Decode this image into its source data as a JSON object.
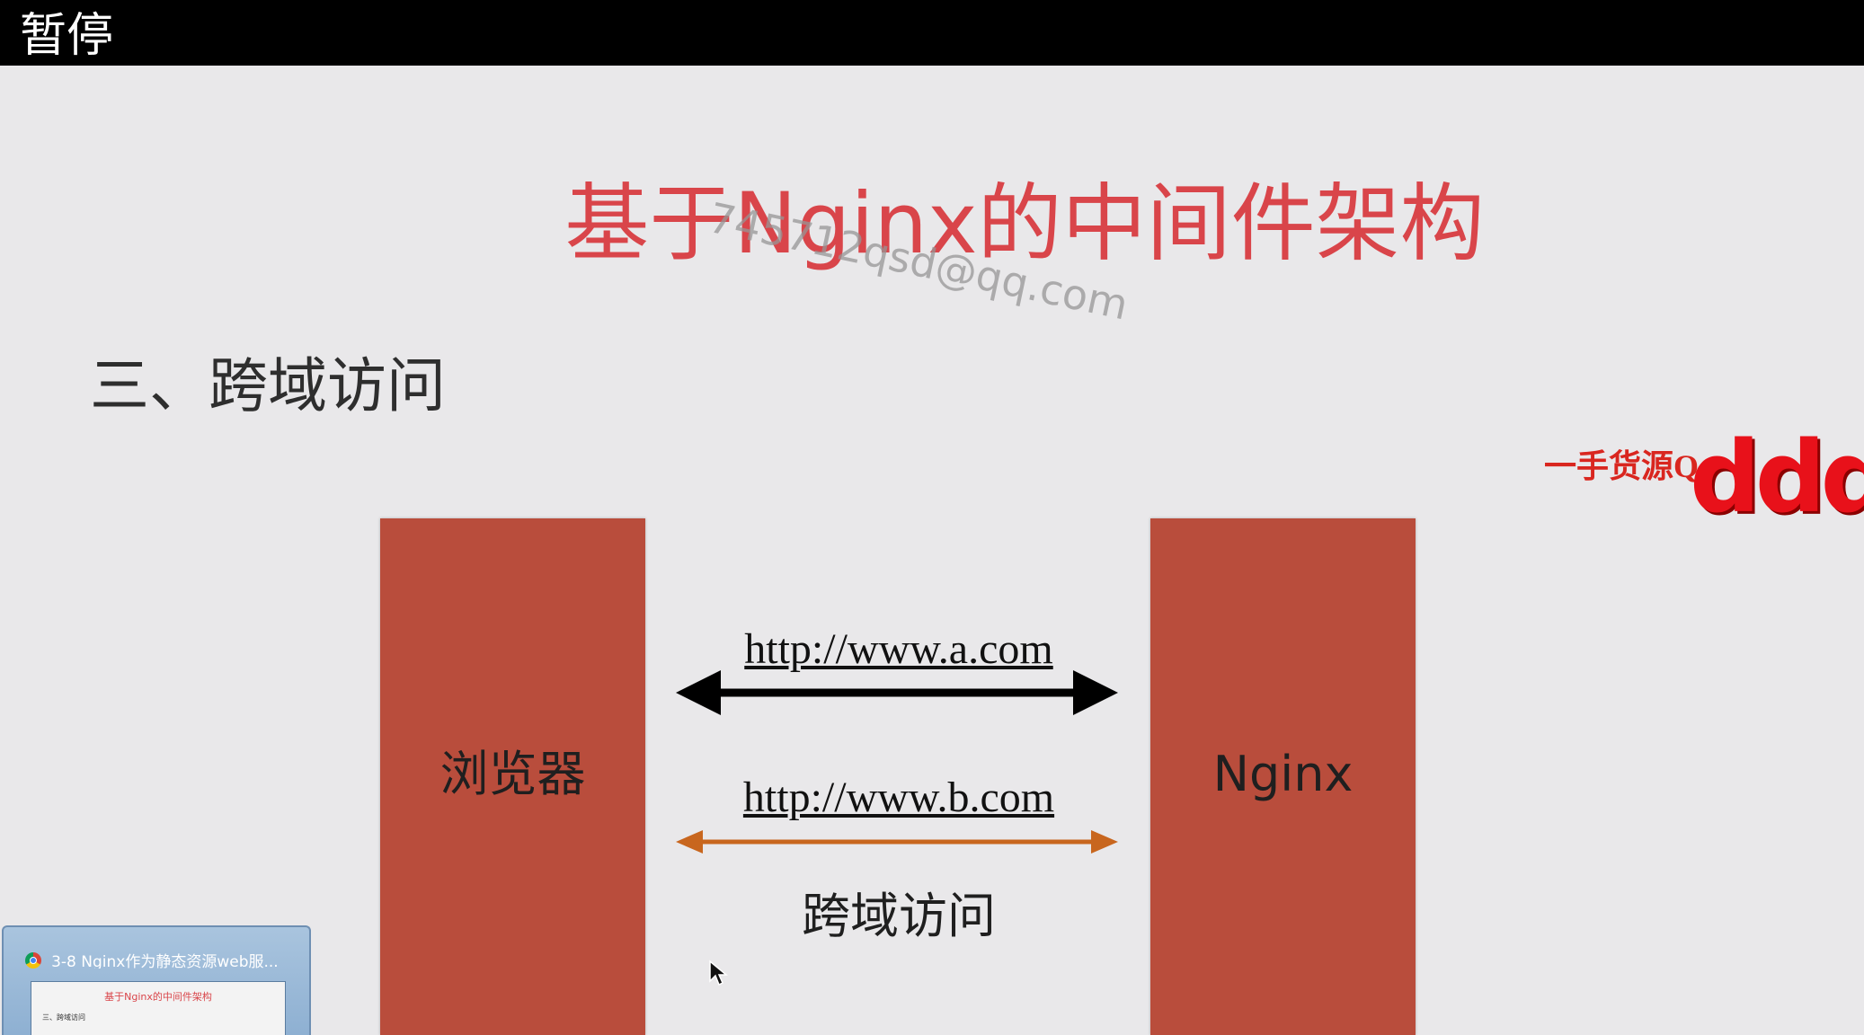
{
  "player": {
    "status_label": "暂停"
  },
  "slide": {
    "title": "基于Nginx的中间件架构",
    "watermark": "745712qsd@qq.com",
    "section_heading": "三、跨域访问",
    "left_box_label": "浏览器",
    "right_box_label": "Nginx",
    "url_a": "http://www.a.com",
    "url_b": "http://www.b.com",
    "cross_domain_label": "跨域访问",
    "arrow_a_color": "#000000",
    "arrow_b_color": "#c8661e",
    "box_color": "#b94d3c",
    "title_color": "#d9454a"
  },
  "overlay": {
    "promo_text": "一手货源Q",
    "promo_block_text": "dddd"
  },
  "taskbar_thumbnail": {
    "window_title": "3-8 Nginx作为静态资源web服...",
    "app_icon": "chrome-icon",
    "preview_title": "基于Nginx的中间件架构",
    "preview_heading": "三、跨域访问"
  }
}
